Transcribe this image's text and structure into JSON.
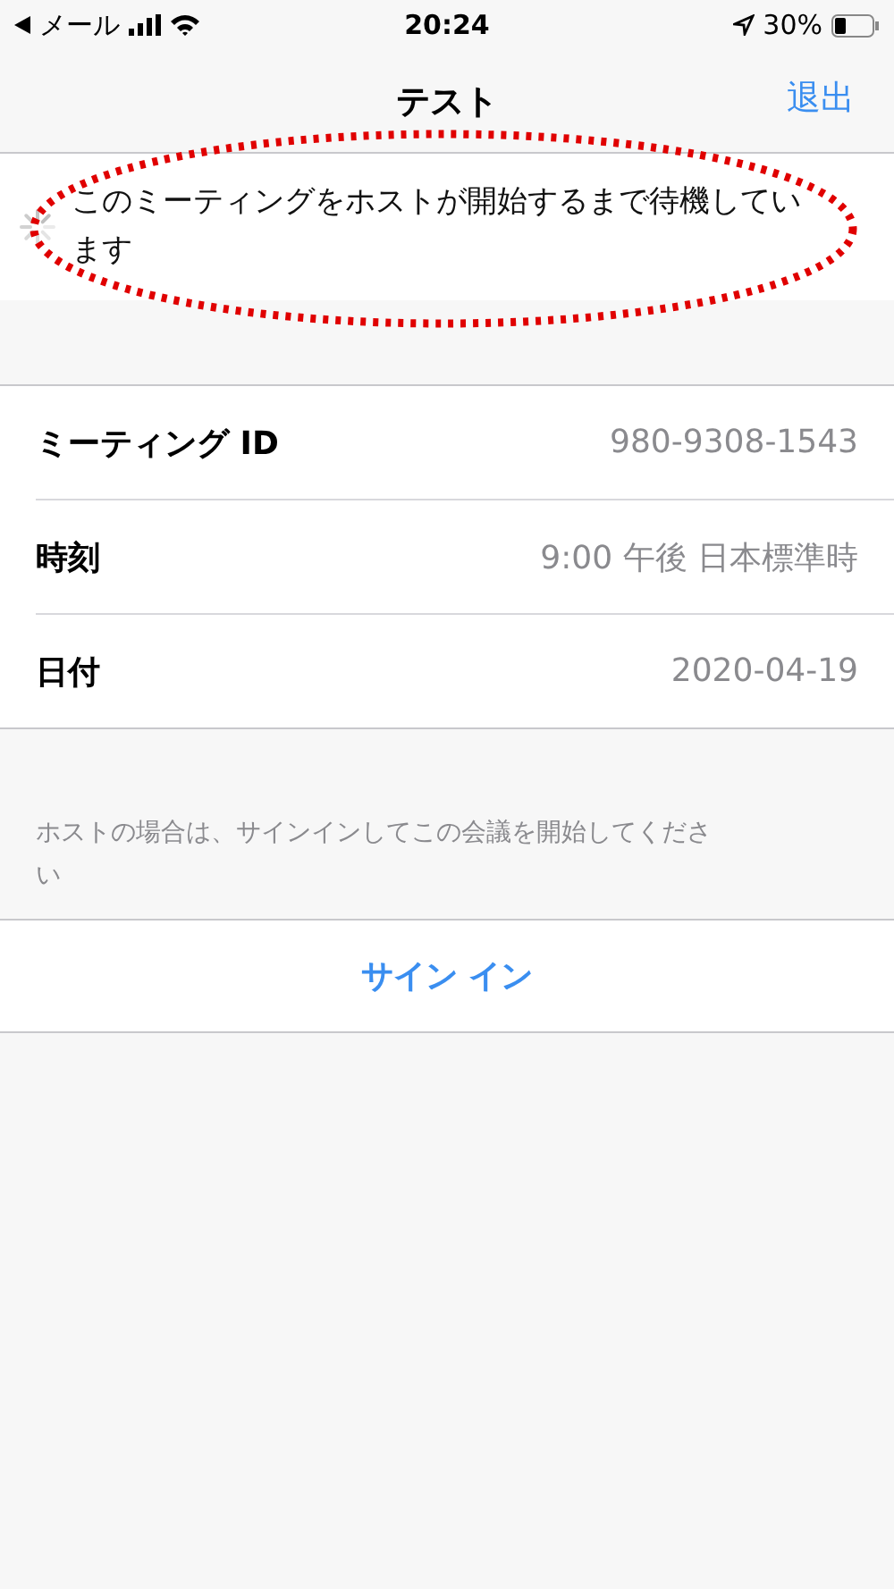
{
  "status_bar": {
    "back_app": "メール",
    "time": "20:24",
    "battery": "30%"
  },
  "nav": {
    "title": "テスト",
    "action": "退出"
  },
  "waiting": {
    "message": "このミーティングをホストが開始するまで待機しています"
  },
  "details": [
    {
      "label": "ミーティング ID",
      "value": "980-9308-1543"
    },
    {
      "label": "時刻",
      "value": "9:00 午後 日本標準時"
    },
    {
      "label": "日付",
      "value": "2020-04-19"
    }
  ],
  "host_note": "ホストの場合は、サインインしてこの会議を開始してください",
  "sign_in_button": "サイン イン"
}
